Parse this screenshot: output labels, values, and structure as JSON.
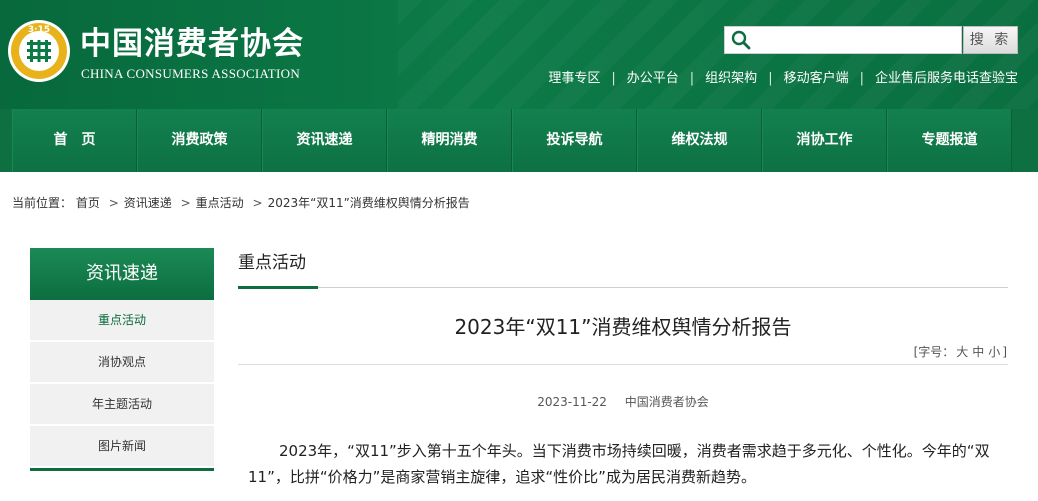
{
  "header": {
    "org_name_cn": "中国消费者协会",
    "org_name_en": "CHINA CONSUMERS ASSOCIATION",
    "logo_icon": "cca-315-emblem-icon",
    "search": {
      "placeholder": "",
      "value": "",
      "button_label": "搜 索"
    },
    "top_links": [
      "理事专区",
      "办公平台",
      "组织架构",
      "移动客户端",
      "企业售后服务电话查验宝"
    ],
    "separator": "|"
  },
  "nav": {
    "items": [
      "首　页",
      "消费政策",
      "资讯速递",
      "精明消费",
      "投诉导航",
      "维权法规",
      "消协工作",
      "专题报道"
    ]
  },
  "breadcrumb": {
    "prefix": "当前位置：",
    "items": [
      "首页",
      "资讯速递",
      "重点活动",
      "2023年“双11”消费维权舆情分析报告"
    ],
    "arrow": ">"
  },
  "sidebar": {
    "title": "资讯速递",
    "items": [
      "重点活动",
      "消协观点",
      "年主题活动",
      "图片新闻"
    ],
    "active_index": 0
  },
  "main": {
    "section_title": "重点活动",
    "article_title": "2023年“双11”消费维权舆情分析报告",
    "font_size": {
      "prefix": "[字号：",
      "large": "大",
      "medium": "中",
      "small": "小",
      "suffix": "]"
    },
    "date": "2023-11-22",
    "source": "中国消费者协会",
    "paragraph": "2023年，“双11”步入第十五个年头。当下消费市场持续回暖，消费者需求趋于多元化、个性化。今年的“双11”，比拼“价格力”是商家营销主旋律，追求“性价比”成为居民消费新趋势。"
  },
  "colors": {
    "brand_green": "#0c7a47",
    "nav_green": "#0e6f41",
    "gold": "#e8b21a"
  }
}
